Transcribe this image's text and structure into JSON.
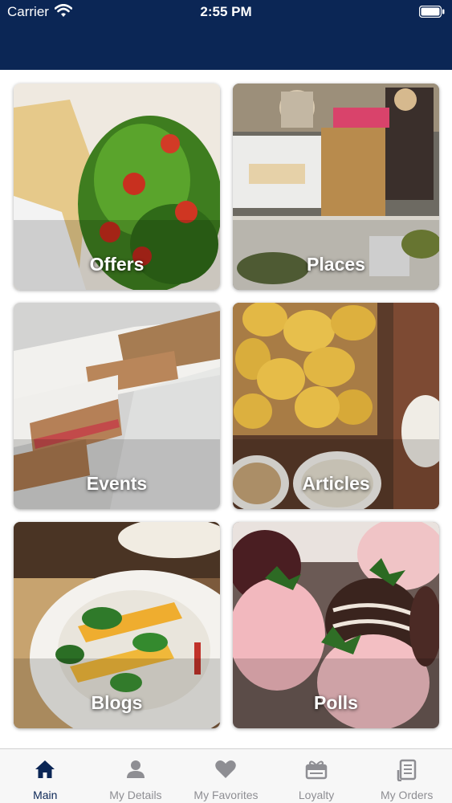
{
  "status_bar": {
    "carrier": "Carrier",
    "time": "2:55 PM"
  },
  "tiles": [
    {
      "label": "Offers"
    },
    {
      "label": "Places"
    },
    {
      "label": "Events"
    },
    {
      "label": "Articles"
    },
    {
      "label": "Blogs"
    },
    {
      "label": "Polls"
    }
  ],
  "tabbar": {
    "active": "Main",
    "items": [
      {
        "label": "Main",
        "icon": "home-icon"
      },
      {
        "label": "My Details",
        "icon": "person-icon"
      },
      {
        "label": "My Favorites",
        "icon": "heart-icon"
      },
      {
        "label": "Loyalty",
        "icon": "gift-icon"
      },
      {
        "label": "My Orders",
        "icon": "receipt-icon"
      }
    ]
  },
  "colors": {
    "header": "#0b2655",
    "active_tab": "#0b2655",
    "inactive_tab": "#8e8e93"
  }
}
